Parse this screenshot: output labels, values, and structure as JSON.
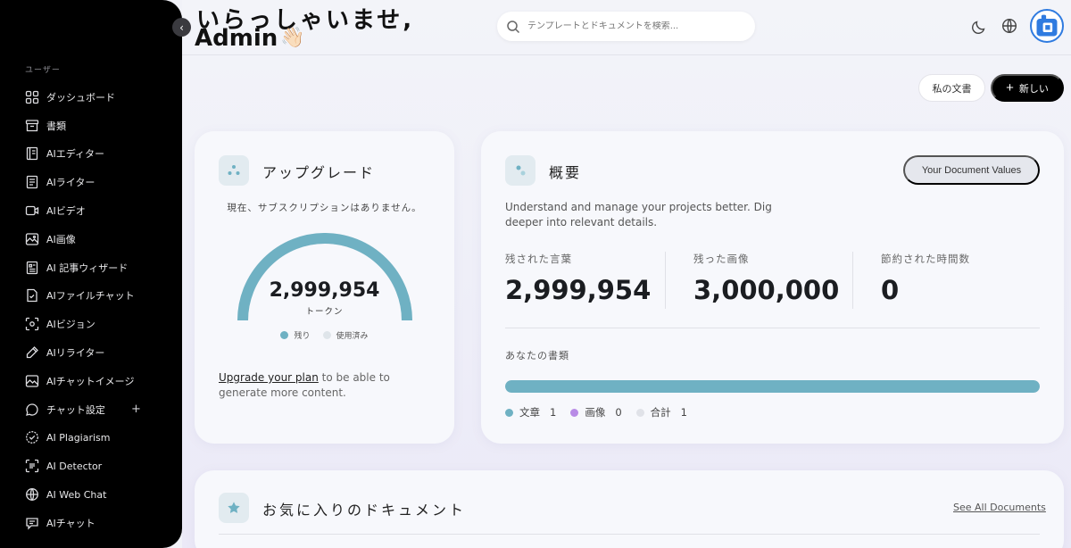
{
  "sidebar": {
    "section": "ユーザー",
    "items": [
      {
        "label": "ダッシュボード",
        "icon": "grid-icon"
      },
      {
        "label": "書類",
        "icon": "archive-icon"
      },
      {
        "label": "AIエディター",
        "icon": "book-icon"
      },
      {
        "label": "AIライター",
        "icon": "document-icon"
      },
      {
        "label": "AIビデオ",
        "icon": "video-icon"
      },
      {
        "label": "AI画像",
        "icon": "image-icon"
      },
      {
        "label": "AI 記事ウィザード",
        "icon": "article-icon"
      },
      {
        "label": "AIファイルチャット",
        "icon": "file-chat-icon"
      },
      {
        "label": "AIビジョン",
        "icon": "scan-eye-icon"
      },
      {
        "label": "AIリライター",
        "icon": "pen-icon"
      },
      {
        "label": "AIチャットイメージ",
        "icon": "chat-image-icon"
      },
      {
        "label": "チャット設定",
        "icon": "chat-bubble-icon"
      },
      {
        "label": "AI Plagiarism",
        "icon": "check-badge-icon"
      },
      {
        "label": "AI Detector",
        "icon": "detector-icon"
      },
      {
        "label": "AI Web Chat",
        "icon": "globe-icon"
      },
      {
        "label": "AIチャット",
        "icon": "chat-icon"
      }
    ],
    "chat_settings_plus": "+"
  },
  "header": {
    "greeting_line1": "いらっしゃいませ,",
    "greeting_line2": "Admin",
    "wave": "👋🏻",
    "search_placeholder": "テンプレートとドキュメントを検索..."
  },
  "actions": {
    "my_docs": "私の文書",
    "new_label": "新しい",
    "new_plus": "+"
  },
  "upgrade": {
    "title": "アップグレード",
    "subtitle": "現在、サブスクリプションはありません。",
    "tokens": "2,999,954",
    "unit": "トークン",
    "legend_remaining": "残り",
    "legend_used": "使用済み",
    "remaining_fraction": 0.99998,
    "link_text": "Upgrade your plan",
    "rest_text": " to be able to generate more content."
  },
  "overview": {
    "title": "概要",
    "values_button": "Your Document Values",
    "description": "Understand and manage your projects better. Dig deeper into relevant details.",
    "stats": [
      {
        "label": "残された言葉",
        "value": "2,999,954"
      },
      {
        "label": "残った画像",
        "value": "3,000,000"
      },
      {
        "label": "節約された時間数",
        "value": "0"
      }
    ],
    "docs_label": "あなたの書類",
    "text_fraction": 1.0,
    "legend": [
      {
        "label": "文章",
        "count": "1",
        "color": "#6fb1c3"
      },
      {
        "label": "画像",
        "count": "0",
        "color": "#b88be6"
      },
      {
        "label": "合計",
        "count": "1",
        "color": "#e0e2e8"
      }
    ]
  },
  "favorites": {
    "title": "お気に入りのドキュメント",
    "see_all": "See All Documents"
  },
  "colors": {
    "accent": "#6fb1c3",
    "image": "#b88be6"
  }
}
